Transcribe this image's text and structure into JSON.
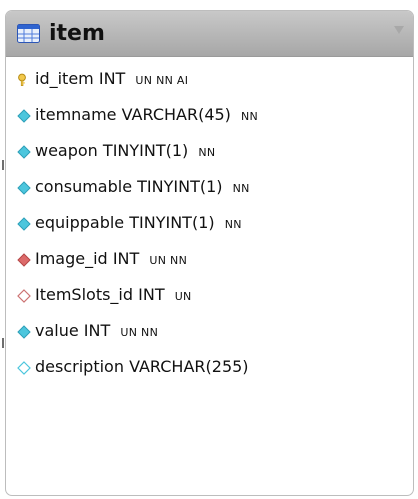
{
  "table": {
    "title": "item",
    "columns": [
      {
        "name": "id_item",
        "type": "INT",
        "flags": "UN NN AI",
        "icon": "primary-key-icon"
      },
      {
        "name": "itemname",
        "type": "VARCHAR(45)",
        "flags": "NN",
        "icon": "column-diamond-icon"
      },
      {
        "name": "weapon",
        "type": "TINYINT(1)",
        "flags": "NN",
        "icon": "column-diamond-icon"
      },
      {
        "name": "consumable",
        "type": "TINYINT(1)",
        "flags": "NN",
        "icon": "column-diamond-icon"
      },
      {
        "name": "equippable",
        "type": "TINYINT(1)",
        "flags": "NN",
        "icon": "column-diamond-icon"
      },
      {
        "name": "Image_id",
        "type": "INT",
        "flags": "UN NN",
        "icon": "foreign-key-icon"
      },
      {
        "name": "ItemSlots_id",
        "type": "INT",
        "flags": "UN",
        "icon": "nullable-foreign-key-icon"
      },
      {
        "name": "value",
        "type": "INT",
        "flags": "UN NN",
        "icon": "column-diamond-icon"
      },
      {
        "name": "description",
        "type": "VARCHAR(255)",
        "flags": "",
        "icon": "nullable-column-icon"
      }
    ]
  },
  "colors": {
    "header_top": "#c8c8c8",
    "header_bottom": "#a7a7a7",
    "primary_key": "#f2c84b",
    "column_diamond": "#4cc6dd",
    "foreign_key": "#dc6a6a",
    "nullable_outline": "#cc7272"
  }
}
